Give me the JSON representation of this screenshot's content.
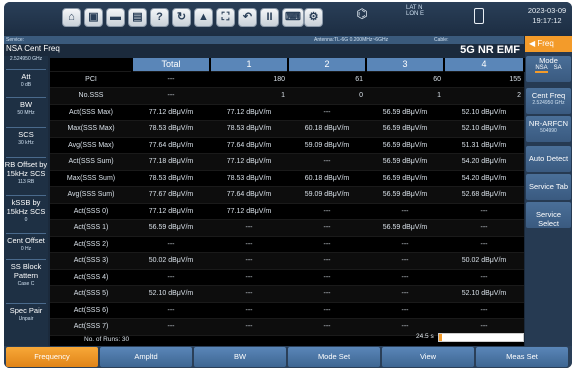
{
  "header": {
    "toolbar_icons": [
      {
        "name": "home-icon",
        "glyph": "⌂"
      },
      {
        "name": "monitor-icon",
        "glyph": "▣"
      },
      {
        "name": "screen-icon",
        "glyph": "▬"
      },
      {
        "name": "save-icon",
        "glyph": "▤"
      },
      {
        "name": "help-icon",
        "glyph": "?"
      },
      {
        "name": "refresh-icon",
        "glyph": "↻"
      },
      {
        "name": "lock-icon",
        "glyph": "▲"
      },
      {
        "name": "fullscreen-icon",
        "glyph": "⛶"
      },
      {
        "name": "undo-icon",
        "glyph": "↶"
      },
      {
        "name": "pause-icon",
        "glyph": "II"
      },
      {
        "name": "keyboard-icon",
        "glyph": "⌨"
      },
      {
        "name": "settings-icon",
        "glyph": "⚙"
      }
    ],
    "gps_label": "LAT N LON E",
    "date": "2023-03-09",
    "time": "19:17:12"
  },
  "status_strip": {
    "left": "Service:",
    "antenna": "Antenna:TL-6G 0.200MHz~6GHz",
    "cable": "Cable:"
  },
  "page": {
    "label": "NSA Cent Freq",
    "mode_title": "5G NR EMF"
  },
  "left_panel": [
    {
      "label": "2.524950 GHz",
      "value": ""
    },
    {
      "label": "Att",
      "value": "0 dB"
    },
    {
      "label": "BW",
      "value": "50 MHz"
    },
    {
      "label": "SCS",
      "value": "30 kHz"
    },
    {
      "label": "RB Offset by 15kHz SCS",
      "value": "113 RB"
    },
    {
      "label": "kSSB by 15kHz SCS",
      "value": "0"
    },
    {
      "label": "Cent Offset",
      "value": "0 Hz"
    },
    {
      "label": "SS Block Pattern",
      "value": "Case C"
    },
    {
      "label": "Spec Pair",
      "value": "Unpair"
    }
  ],
  "table": {
    "columns": [
      "",
      "Total",
      "1",
      "2",
      "3",
      "4"
    ],
    "rows": [
      {
        "label": "PCI",
        "cells": [
          "---",
          "180",
          "61",
          "60",
          "155"
        ],
        "align": "right"
      },
      {
        "label": "No.SSS",
        "cells": [
          "---",
          "1",
          "0",
          "1",
          "2"
        ],
        "align": "right"
      },
      {
        "label": "Act(SSS Max)",
        "cells": [
          "77.12 dBμV/m",
          "77.12 dBμV/m",
          "---",
          "56.59 dBμV/m",
          "52.10 dBμV/m"
        ]
      },
      {
        "label": "Max(SSS Max)",
        "cells": [
          "78.53 dBμV/m",
          "78.53 dBμV/m",
          "60.18 dBμV/m",
          "56.59 dBμV/m",
          "52.10 dBμV/m"
        ]
      },
      {
        "label": "Avg(SSS Max)",
        "cells": [
          "77.64 dBμV/m",
          "77.64 dBμV/m",
          "59.09 dBμV/m",
          "56.59 dBμV/m",
          "51.31 dBμV/m"
        ]
      },
      {
        "label": "Act(SSS Sum)",
        "cells": [
          "77.18 dBμV/m",
          "77.12 dBμV/m",
          "---",
          "56.59 dBμV/m",
          "54.20 dBμV/m"
        ]
      },
      {
        "label": "Max(SSS Sum)",
        "cells": [
          "78.53 dBμV/m",
          "78.53 dBμV/m",
          "60.18 dBμV/m",
          "56.59 dBμV/m",
          "54.20 dBμV/m"
        ]
      },
      {
        "label": "Avg(SSS Sum)",
        "cells": [
          "77.67 dBμV/m",
          "77.64 dBμV/m",
          "59.09 dBμV/m",
          "56.59 dBμV/m",
          "52.68 dBμV/m"
        ]
      },
      {
        "label": "Act(SSS 0)",
        "cells": [
          "77.12 dBμV/m",
          "77.12 dBμV/m",
          "---",
          "---",
          "---"
        ]
      },
      {
        "label": "Act(SSS 1)",
        "cells": [
          "56.59 dBμV/m",
          "---",
          "---",
          "56.59 dBμV/m",
          "---"
        ]
      },
      {
        "label": "Act(SSS 2)",
        "cells": [
          "---",
          "---",
          "---",
          "---",
          "---"
        ]
      },
      {
        "label": "Act(SSS 3)",
        "cells": [
          "50.02 dBμV/m",
          "---",
          "---",
          "---",
          "50.02 dBμV/m"
        ]
      },
      {
        "label": "Act(SSS 4)",
        "cells": [
          "---",
          "---",
          "---",
          "---",
          "---"
        ]
      },
      {
        "label": "Act(SSS 5)",
        "cells": [
          "52.10 dBμV/m",
          "---",
          "---",
          "---",
          "52.10 dBμV/m"
        ]
      },
      {
        "label": "Act(SSS 6)",
        "cells": [
          "---",
          "---",
          "---",
          "---",
          "---"
        ]
      },
      {
        "label": "Act(SSS 7)",
        "cells": [
          "---",
          "---",
          "---",
          "---",
          "---"
        ]
      }
    ],
    "runs_label": "No. of Runs: 30",
    "progress_text": "24.5 s",
    "progress_fraction": 0.04
  },
  "right_panel": {
    "header": "Freq",
    "mode_label": "Mode",
    "mode_options": [
      "NSA",
      "SA"
    ],
    "keys": [
      {
        "label": "Cent Freq",
        "sub": "2.524950 GHz"
      },
      {
        "label": "NR-ARFCN",
        "sub": "504990"
      },
      {
        "label": "Auto Detect",
        "sub": ""
      },
      {
        "label": "Service Tab",
        "sub": ""
      },
      {
        "label": "Service Select",
        "sub": ""
      }
    ]
  },
  "bottom_bar": [
    "Frequency",
    "Ampltd",
    "BW",
    "Mode Set",
    "View",
    "Meas Set"
  ],
  "colors": {
    "accent": "#f39b2a",
    "header": "#5a86b8",
    "background": "#1b2a3c"
  }
}
